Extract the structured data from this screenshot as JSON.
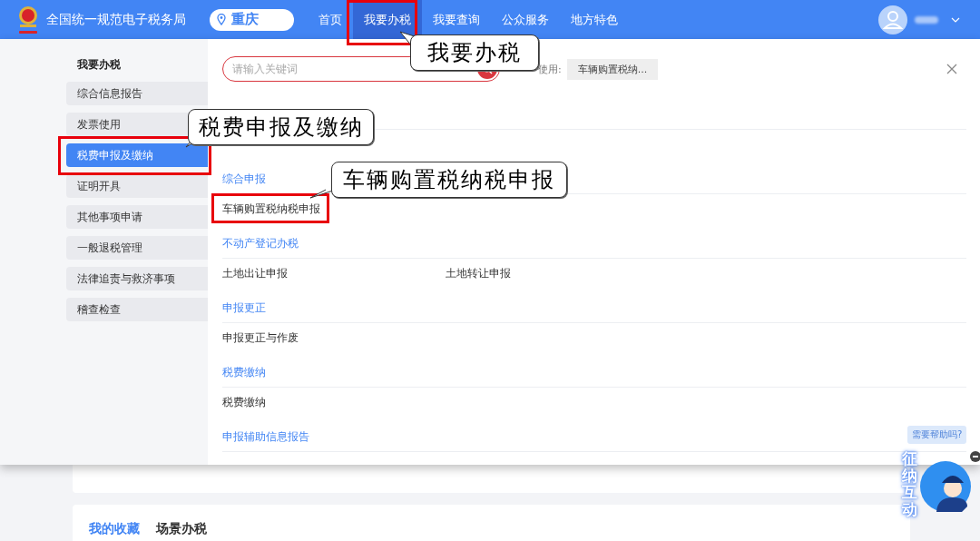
{
  "header": {
    "site_title": "全国统一规范电子税务局",
    "region": "重庆",
    "nav": [
      {
        "label": "首页",
        "selected": false
      },
      {
        "label": "我要办税",
        "selected": true
      },
      {
        "label": "我要查询",
        "selected": false
      },
      {
        "label": "公众服务",
        "selected": false
      },
      {
        "label": "地方特色",
        "selected": false
      }
    ]
  },
  "menu_panel": {
    "sidebar": {
      "title": "我要办税",
      "items": [
        {
          "label": "综合信息报告",
          "selected": false
        },
        {
          "label": "发票使用",
          "selected": false
        },
        {
          "label": "税费申报及缴纳",
          "selected": true
        },
        {
          "label": "证明开具",
          "selected": false
        },
        {
          "label": "其他事项申请",
          "selected": false
        },
        {
          "label": "一般退税管理",
          "selected": false
        },
        {
          "label": "法律追责与救济事项",
          "selected": false
        },
        {
          "label": "稽查检查",
          "selected": false
        }
      ]
    },
    "search": {
      "placeholder": "请输入关键词"
    },
    "recent": {
      "label": "使用:",
      "chip": "车辆购置税纳..."
    },
    "sections": [
      {
        "title": "综合申报",
        "items": [
          "车辆购置税纳税申报"
        ]
      },
      {
        "title": "不动产登记办税",
        "items": [
          "土地出让申报",
          "土地转让申报"
        ]
      },
      {
        "title": "申报更正",
        "items": [
          "申报更正与作废"
        ]
      },
      {
        "title": "税费缴纳",
        "items": [
          "税费缴纳"
        ]
      },
      {
        "title": "申报辅助信息报告"
      }
    ]
  },
  "page_tabs": [
    {
      "label": "我的收藏",
      "selected": true
    },
    {
      "label": "场景办税",
      "selected": false
    }
  ],
  "assistant": {
    "prompt": "需要帮助吗?",
    "label": "征纳互动"
  },
  "annotations": [
    {
      "text": "我要办税"
    },
    {
      "text": "税费申报及缴纳"
    },
    {
      "text": "车辆购置税纳税申报"
    }
  ]
}
